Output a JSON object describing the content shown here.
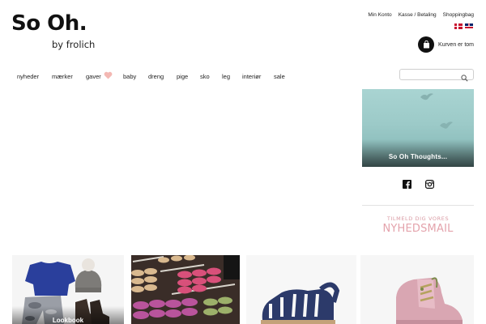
{
  "header": {
    "logo_main": "So Oh.",
    "logo_sub": "by frolich",
    "top_links": [
      "Min Konto",
      "Kasse / Betaling",
      "Shoppingbag"
    ],
    "cart_label": "Kurven er tom",
    "languages": [
      "da",
      "en"
    ]
  },
  "nav": {
    "items": [
      "nyheder",
      "mærker",
      "gaver",
      "baby",
      "dreng",
      "pige",
      "sko",
      "leg",
      "interiør",
      "sale"
    ]
  },
  "search": {
    "placeholder": "",
    "value": ""
  },
  "sidebar": {
    "thoughts_label": "So Oh Thoughts...",
    "social": [
      "facebook-icon",
      "instagram-icon"
    ],
    "newsletter_line1": "TILMELD DIG VORES",
    "newsletter_line2": "NYHEDSMAIL"
  },
  "tiles": [
    {
      "label": "Lookbook"
    },
    {
      "label": ""
    },
    {
      "label": ""
    },
    {
      "label": ""
    }
  ],
  "colors": {
    "accent_pink": "#e4a3ac",
    "text": "#222222",
    "thoughts_bg": "#9ccac8"
  }
}
